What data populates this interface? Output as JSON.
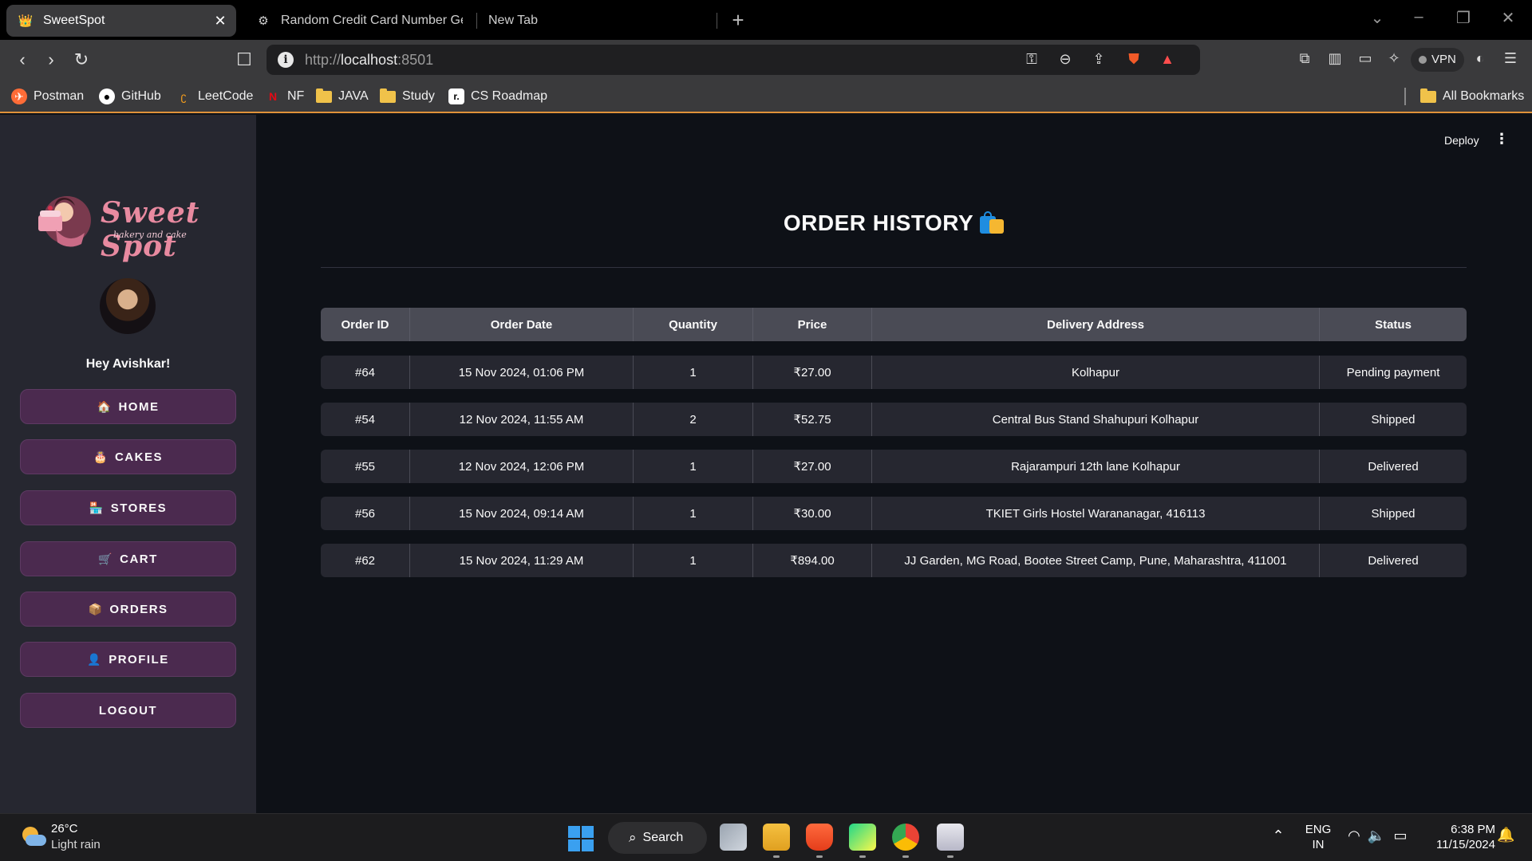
{
  "browser": {
    "tabs": [
      {
        "title": "SweetSpot",
        "icon": "crown-icon",
        "active": true
      },
      {
        "title": "Random Credit Card Number Gene",
        "icon": "gear-icon",
        "active": false
      },
      {
        "title": "New Tab",
        "icon": "",
        "active": false
      }
    ],
    "url": {
      "scheme": "http://",
      "host": "localhost",
      "port": ":8501"
    },
    "vpn_label": "VPN",
    "bookmarks": [
      {
        "label": "Postman",
        "icon": "postman-icon"
      },
      {
        "label": "GitHub",
        "icon": "github-icon"
      },
      {
        "label": "LeetCode",
        "icon": "leetcode-icon"
      },
      {
        "label": "NF",
        "icon": "netflix-icon"
      },
      {
        "label": "JAVA",
        "icon": "folder-icon"
      },
      {
        "label": "Study",
        "icon": "folder-icon"
      },
      {
        "label": "CS Roadmap",
        "icon": "roadmap-icon"
      }
    ],
    "all_bookmarks": "All Bookmarks"
  },
  "app": {
    "toolbar": {
      "deploy_label": "Deploy",
      "menu_glyph": "⋮"
    },
    "brand": {
      "name": "Sweet Spot",
      "tagline": "bakery and cake"
    },
    "greeting": "Hey Avishkar!",
    "menu": [
      {
        "label": "HOME",
        "icon": "🏠",
        "icon_name": "house-icon"
      },
      {
        "label": "CAKES",
        "icon": "🎂",
        "icon_name": "cake-icon"
      },
      {
        "label": "STORES",
        "icon": "🏪",
        "icon_name": "store-icon"
      },
      {
        "label": "CART",
        "icon": "🛒",
        "icon_name": "cart-icon"
      },
      {
        "label": "ORDERS",
        "icon": "📦",
        "icon_name": "package-icon"
      },
      {
        "label": "PROFILE",
        "icon": "👤",
        "icon_name": "person-icon"
      },
      {
        "label": "LOGOUT",
        "icon": "",
        "icon_name": ""
      }
    ],
    "page_title": "ORDER HISTORY",
    "orders": {
      "columns": [
        "Order ID",
        "Order Date",
        "Quantity",
        "Price",
        "Delivery Address",
        "Status"
      ],
      "rows": [
        [
          "#64",
          "15 Nov 2024, 01:06 PM",
          "1",
          "₹27.00",
          "Kolhapur",
          "Pending payment"
        ],
        [
          "#54",
          "12 Nov 2024, 11:55 AM",
          "2",
          "₹52.75",
          "Central Bus Stand Shahupuri Kolhapur",
          "Shipped"
        ],
        [
          "#55",
          "12 Nov 2024, 12:06 PM",
          "1",
          "₹27.00",
          "Rajarampuri 12th lane Kolhapur",
          "Delivered"
        ],
        [
          "#56",
          "15 Nov 2024, 09:14 AM",
          "1",
          "₹30.00",
          "TKIET Girls Hostel Warananagar, 416113",
          "Shipped"
        ],
        [
          "#62",
          "15 Nov 2024, 11:29 AM",
          "1",
          "₹894.00",
          "JJ Garden, MG Road, Bootee Street Camp, Pune, Maharashtra, 411001",
          "Delivered"
        ]
      ]
    }
  },
  "taskbar": {
    "weather": {
      "temp": "26°C",
      "condition": "Light rain"
    },
    "search_label": "Search",
    "lang": {
      "line1": "ENG",
      "line2": "IN"
    },
    "clock": {
      "time": "6:38 PM",
      "date": "11/15/2024"
    }
  },
  "colors": {
    "sidebar_bg": "#262730",
    "main_bg": "#0e1117",
    "menu_button": "#4b2a4f",
    "table_header": "#4a4b55",
    "table_row": "#262730",
    "brand_pink": "#e88aa0",
    "accent_line": "#e0923a"
  }
}
